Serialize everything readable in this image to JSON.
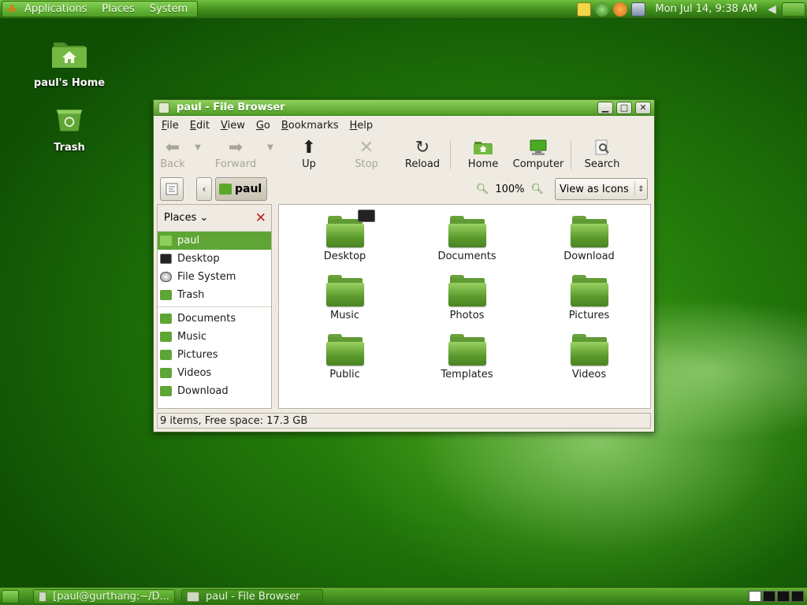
{
  "top_panel": {
    "menus": [
      "Applications",
      "Places",
      "System"
    ],
    "clock": "Mon Jul 14,  9:38 AM"
  },
  "desktop": {
    "icons": [
      {
        "label": "paul's Home",
        "icon": "home-folder-icon"
      },
      {
        "label": "Trash",
        "icon": "trash-icon"
      }
    ]
  },
  "window": {
    "title": "paul - File Browser",
    "menubar": [
      {
        "label": "File",
        "mnemonic": "F",
        "rest": "ile"
      },
      {
        "label": "Edit",
        "mnemonic": "E",
        "rest": "dit"
      },
      {
        "label": "View",
        "mnemonic": "V",
        "rest": "iew"
      },
      {
        "label": "Go",
        "mnemonic": "G",
        "rest": "o"
      },
      {
        "label": "Bookmarks",
        "mnemonic": "B",
        "rest": "ookmarks"
      },
      {
        "label": "Help",
        "mnemonic": "H",
        "rest": "elp"
      }
    ],
    "toolbar": {
      "back": "Back",
      "forward": "Forward",
      "up": "Up",
      "stop": "Stop",
      "reload": "Reload",
      "home": "Home",
      "computer": "Computer",
      "search": "Search"
    },
    "location": {
      "crumb": "paul",
      "zoom": "100%",
      "view_mode": "View as Icons"
    },
    "sidebar": {
      "header": "Places",
      "items": [
        {
          "label": "paul",
          "icon": "home-icon",
          "selected": true
        },
        {
          "label": "Desktop",
          "icon": "desktop-icon"
        },
        {
          "label": "File System",
          "icon": "harddisk-icon"
        },
        {
          "label": "Trash",
          "icon": "trash-icon"
        }
      ],
      "bookmarks": [
        {
          "label": "Documents",
          "icon": "folder-icon"
        },
        {
          "label": "Music",
          "icon": "folder-icon"
        },
        {
          "label": "Pictures",
          "icon": "folder-icon"
        },
        {
          "label": "Videos",
          "icon": "folder-icon"
        },
        {
          "label": "Download",
          "icon": "folder-icon"
        }
      ]
    },
    "files": [
      "Desktop",
      "Documents",
      "Download",
      "Music",
      "Photos",
      "Pictures",
      "Public",
      "Templates",
      "Videos"
    ],
    "status": "9 items, Free space: 17.3 GB"
  },
  "bottom_panel": {
    "tasks": [
      "[paul@gurthang:~/D...",
      "paul - File Browser"
    ]
  },
  "colors": {
    "accent": "#5fa536",
    "panel": "#3f8d1b"
  }
}
